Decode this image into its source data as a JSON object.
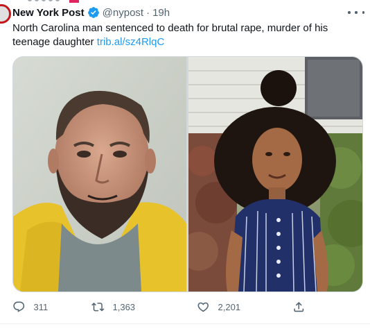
{
  "tweet": {
    "author_name": "New York Post",
    "handle": "@nypost",
    "separator": "·",
    "time": "19h",
    "text": "North Carolina man sentenced to death for brutal rape, murder of his teenage daughter ",
    "link": "trib.al/sz4RlqC"
  },
  "icons": {
    "verified": "verified-badge-icon",
    "more": "more-options-icon",
    "reply": "reply-icon",
    "retweet": "retweet-icon",
    "like": "heart-icon",
    "share": "share-icon"
  },
  "actions": {
    "replies": "311",
    "retweets": "1,363",
    "likes": "2,201"
  },
  "colors": {
    "brand_red": "#c4171c",
    "link_blue": "#1d9bf0",
    "muted_text": "#536471",
    "verified_blue": "#1d9bf0"
  }
}
